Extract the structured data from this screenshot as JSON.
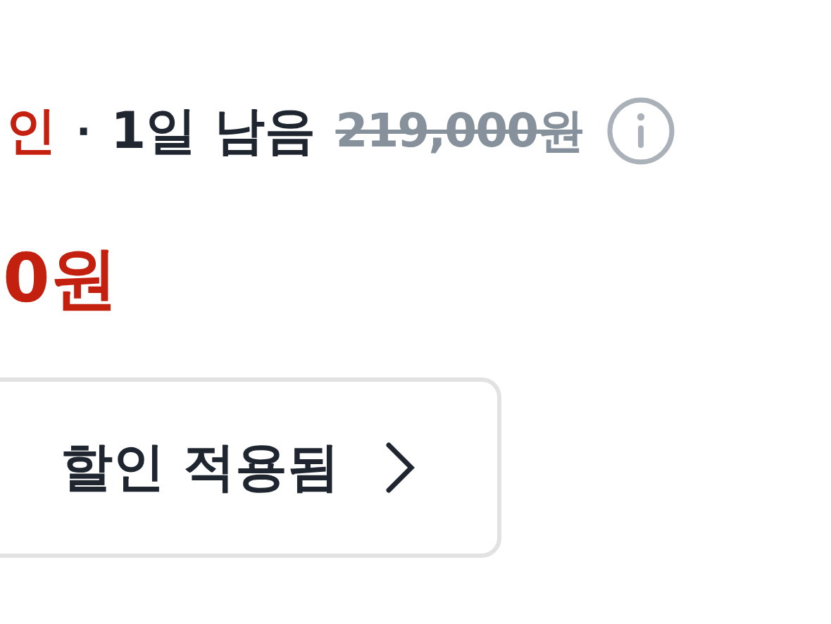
{
  "deal": {
    "discount_label": "인",
    "separator": "·",
    "time_left": "1일 남음",
    "original_price": "219,000원"
  },
  "price": {
    "sale_price": "0원"
  },
  "coupon_button": {
    "label": "할인 적용됨"
  }
}
